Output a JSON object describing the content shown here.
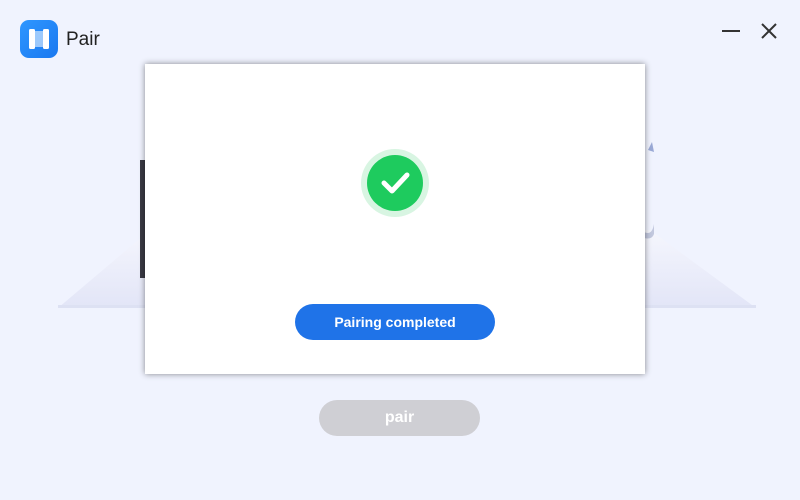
{
  "app": {
    "title": "Pair",
    "logo_icon": "book-app-icon",
    "accent_color": "#1f73e8"
  },
  "window_controls": {
    "minimize_icon": "minimize-icon",
    "close_icon": "close-icon"
  },
  "main": {
    "pair_button_label": "pair",
    "pair_button_state": "disabled"
  },
  "dialog": {
    "status_icon": "check-circle-icon",
    "status_color": "#1ecb5e",
    "status_button_label": "Pairing completed"
  }
}
